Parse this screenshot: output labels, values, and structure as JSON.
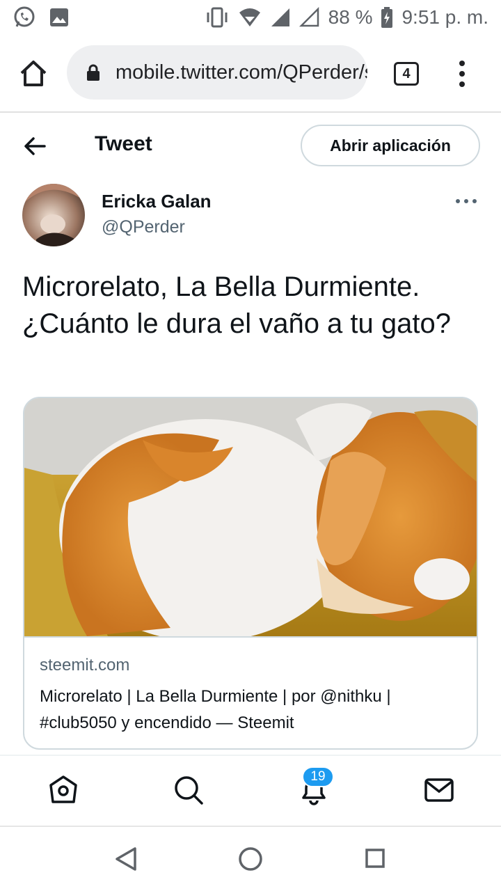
{
  "status_bar": {
    "battery": "88 %",
    "time": "9:51 p. m.",
    "icons": [
      "whatsapp-icon",
      "image-icon",
      "vibrate-icon",
      "wifi-icon",
      "signal-icon",
      "signal-empty-icon",
      "battery-icon"
    ]
  },
  "browser": {
    "url": "mobile.twitter.com/QPerder/status",
    "tab_count": "4"
  },
  "header": {
    "title": "Tweet",
    "open_app_label": "Abrir aplicación"
  },
  "author": {
    "name": "Ericka Galan",
    "handle": "@QPerder"
  },
  "tweet": {
    "text": "Microrelato, La Bella Durmiente. ¿Cuánto le dura el vaño a tu gato?"
  },
  "card": {
    "domain": "steemit.com",
    "title": "Microrelato | La Bella Durmiente | por @nithku | #club5050 y encendido — Steemit"
  },
  "bottom_nav": {
    "notification_count": "19",
    "items": [
      "home-icon",
      "search-icon",
      "notifications-icon",
      "messages-icon"
    ]
  },
  "colors": {
    "accent": "#1d9bf0",
    "text_primary": "#0f1419",
    "text_secondary": "#536471",
    "border": "#cfd9de"
  }
}
